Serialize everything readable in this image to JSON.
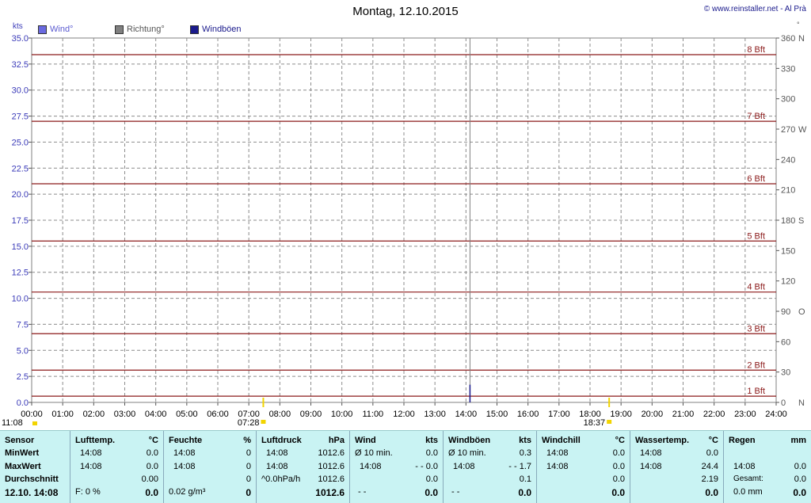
{
  "header": {
    "title": "Montag, 12.10.2015",
    "copyright": "© www.reinstaller.net - Al Prà"
  },
  "legend": [
    {
      "label": "Wind°",
      "color": "#6a6ae0"
    },
    {
      "label": "Richtung°",
      "color": "#808080"
    },
    {
      "label": "Windböen",
      "color": "#1a1a8c"
    }
  ],
  "chart_data": {
    "type": "line",
    "title": "Montag, 12.10.2015",
    "y_left_unit": "kts",
    "y_right_unit": "°",
    "y_left_range": [
      0,
      35
    ],
    "y_left_ticks": [
      "0.0",
      "2.5",
      "5.0",
      "7.5",
      "10.0",
      "12.5",
      "15.0",
      "17.5",
      "20.0",
      "22.5",
      "25.0",
      "27.5",
      "30.0",
      "32.5",
      "35.0"
    ],
    "y_right_range": [
      0,
      360
    ],
    "y_right_ticks": [
      {
        "v": 0,
        "label": "0",
        "dir": "N"
      },
      {
        "v": 30,
        "label": "30",
        "dir": ""
      },
      {
        "v": 60,
        "label": "60",
        "dir": ""
      },
      {
        "v": 90,
        "label": "90",
        "dir": "O"
      },
      {
        "v": 120,
        "label": "120",
        "dir": ""
      },
      {
        "v": 150,
        "label": "150",
        "dir": ""
      },
      {
        "v": 180,
        "label": "180",
        "dir": "S"
      },
      {
        "v": 210,
        "label": "210",
        "dir": ""
      },
      {
        "v": 240,
        "label": "240",
        "dir": ""
      },
      {
        "v": 270,
        "label": "270",
        "dir": "W"
      },
      {
        "v": 300,
        "label": "300",
        "dir": ""
      },
      {
        "v": 330,
        "label": "330",
        "dir": ""
      },
      {
        "v": 360,
        "label": "360",
        "dir": "N"
      }
    ],
    "x_ticks": [
      "00:00",
      "01:00",
      "02:00",
      "03:00",
      "04:00",
      "05:00",
      "06:00",
      "07:00",
      "08:00",
      "09:00",
      "10:00",
      "11:00",
      "12:00",
      "13:00",
      "14:00",
      "15:00",
      "16:00",
      "17:00",
      "18:00",
      "19:00",
      "20:00",
      "21:00",
      "22:00",
      "23:00",
      "24:00"
    ],
    "x_range_hours": [
      0,
      24
    ],
    "beaufort_lines": [
      {
        "label": "1 Bft",
        "kts": 0.6
      },
      {
        "label": "2 Bft",
        "kts": 3.1
      },
      {
        "label": "3 Bft",
        "kts": 6.6
      },
      {
        "label": "4 Bft",
        "kts": 10.6
      },
      {
        "label": "5 Bft",
        "kts": 15.5
      },
      {
        "label": "6 Bft",
        "kts": 21.0
      },
      {
        "label": "7 Bft",
        "kts": 27.0
      },
      {
        "label": "8 Bft",
        "kts": 33.4
      }
    ],
    "series": [
      {
        "name": "Windböen",
        "color": "#1a1a8c",
        "points": [
          {
            "t": 14.13,
            "kts": 0.0
          },
          {
            "t": 14.13,
            "kts": 1.7
          }
        ]
      }
    ],
    "current_time_marker": 14.13,
    "daylength": {
      "daylength_label": "11:08",
      "sunrise": "07:28",
      "sunset": "18:37",
      "sunrise_h": 7.467,
      "sunset_h": 18.617
    },
    "grid": true
  },
  "stats": {
    "sensor": {
      "hdr": "Sensor",
      "rows": [
        "MinWert",
        "MaxWert",
        "Durchschnitt",
        "12.10. 14:08"
      ]
    },
    "lufttemp": {
      "hdr": "Lufttemp.",
      "unit": "°C",
      "r1a": "14:08",
      "r1b": "0.0",
      "r2a": "14:08",
      "r2b": "0.0",
      "r3b": "0.00",
      "r4a": "F: 0 %",
      "r4b": "0.0"
    },
    "feuchte": {
      "hdr": "Feuchte",
      "unit": "%",
      "r1a": "14:08",
      "r1b": "0",
      "r2a": "14:08",
      "r2b": "0",
      "r3b": "0",
      "r4a": "0.02 g/m³",
      "r4b": "0"
    },
    "luftdruck": {
      "hdr": "Luftdruck",
      "unit": "hPa",
      "r1a": "14:08",
      "r1b": "1012.6",
      "r2a": "14:08",
      "r2b": "1012.6",
      "r3a": "^0.0hPa/h",
      "r3b": "1012.6",
      "r4b": "1012.6"
    },
    "wind": {
      "hdr": "Wind",
      "unit": "kts",
      "r1a": "Ø 10 min.",
      "r1b": "0.0",
      "r2a": "14:08",
      "r2b": "- - 0.0",
      "r3b": "0.0",
      "r4a": "- -",
      "r4b": "0.0"
    },
    "windboeen": {
      "hdr": "Windböen",
      "unit": "kts",
      "r1a": "Ø 10 min.",
      "r1b": "0.3",
      "r2a": "14:08",
      "r2b": "- - 1.7",
      "r3b": "0.1",
      "r4a": "- -",
      "r4b": "0.0"
    },
    "windchill": {
      "hdr": "Windchill",
      "unit": "°C",
      "r1a": "14:08",
      "r1b": "0.0",
      "r2a": "14:08",
      "r2b": "0.0",
      "r3b": "0.0",
      "r4b": "0.0"
    },
    "wassertemp": {
      "hdr": "Wassertemp.",
      "unit": "°C",
      "r1a": "14:08",
      "r1b": "0.0",
      "r2a": "14:08",
      "r2b": "24.4",
      "r3b": "2.19",
      "r4b": "0.0"
    },
    "regen": {
      "hdr": "Regen",
      "unit": "mm",
      "r2a": "14:08",
      "r2b": "0.0",
      "r3a": "Gesamt:",
      "r3b": "0.0",
      "r4a": "0.0 mm",
      "r4b": "0.0"
    }
  }
}
